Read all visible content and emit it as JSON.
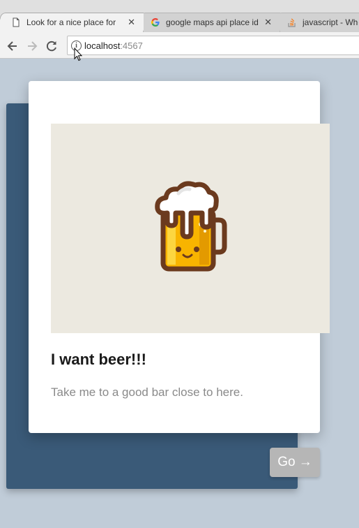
{
  "browser": {
    "tabs": [
      {
        "title": "Look for a nice place for",
        "icon": "document-icon",
        "active": true
      },
      {
        "title": "google maps api place id",
        "icon": "google-icon",
        "active": false
      },
      {
        "title": "javascript - Whe",
        "icon": "stackoverflow-icon",
        "active": false
      }
    ],
    "close_glyph": "✕",
    "url_host": "localhost",
    "url_port": ":4567"
  },
  "card": {
    "title": "I want beer!!!",
    "subtitle": "Take me to a good bar close to here.",
    "illustration": "beer-mug-icon"
  },
  "action": {
    "go_label": "Go →"
  },
  "colors": {
    "page_background": "#c0ccd8",
    "back_card": "#3a5a78",
    "illustration_background": "#ece9e0",
    "go_button": "#b6b6b6"
  }
}
